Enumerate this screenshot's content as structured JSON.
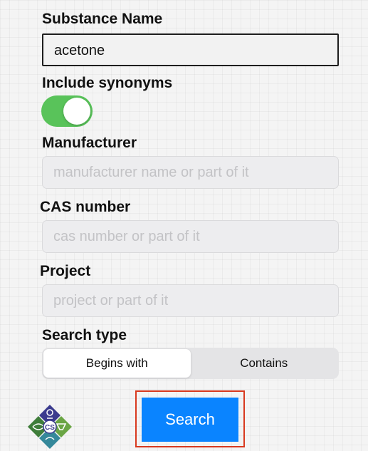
{
  "form": {
    "substance_name": {
      "label": "Substance Name",
      "value": "acetone"
    },
    "include_synonyms": {
      "label": "Include synonyms",
      "checked": true,
      "on_color": "#59c35a"
    },
    "manufacturer": {
      "label": "Manufacturer",
      "placeholder": "manufacturer name or part of it"
    },
    "cas_number": {
      "label": "CAS number",
      "placeholder": "cas number or part of it"
    },
    "project": {
      "label": "Project",
      "placeholder": "project or part of it"
    },
    "search_type": {
      "label": "Search type",
      "options": [
        "Begins with",
        "Contains"
      ],
      "selected": "Begins with"
    },
    "search_button": {
      "label": "Search",
      "color": "#0a84ff",
      "highlight_color": "#d8391f"
    }
  },
  "logo": {
    "icon": "chemical-safety-diamond-logo",
    "text": "CS"
  }
}
